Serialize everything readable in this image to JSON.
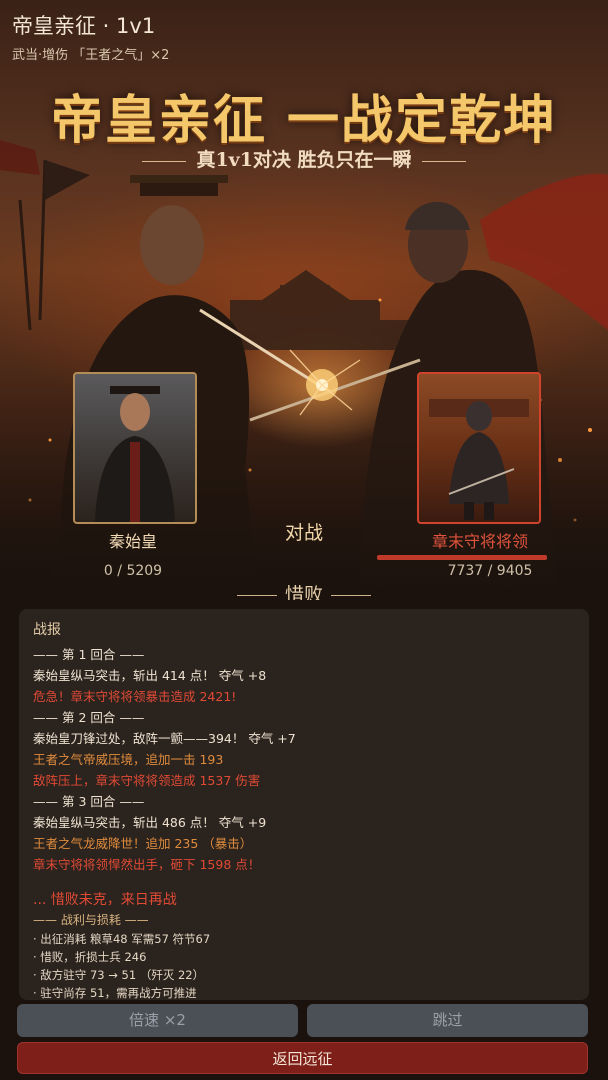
{
  "header": {
    "title": "帝皇亲征 · 1v1",
    "subtitle": "武当·增伤 「王者之气」×2"
  },
  "banner": {
    "title": "帝皇亲征 一战定乾坤",
    "tagline": "真1v1对决 胜负只在一瞬"
  },
  "battle": {
    "left": {
      "name": "秦始皇",
      "hp": "0 / 5209"
    },
    "vs": "对战",
    "right": {
      "name": "章末守将将领",
      "hp": "7737 / 9405"
    },
    "result": "惜败"
  },
  "log": {
    "heading": "战报",
    "lines": [
      "—— 第 1 回合 ——",
      "秦始皇纵马突击，斩出 414 点！ 夺气 +8",
      "危急！章末守将将领暴击造成 2421!",
      "—— 第 2 回合 ——",
      "秦始皇刀锋过处，敌阵一颤——394！ 夺气 +7",
      "王者之气帝威压境，追加一击 193",
      "敌阵压上，章末守将将领造成 1537 伤害",
      "—— 第 3 回合 ——",
      "秦始皇纵马突击，斩出 486 点！ 夺气 +9",
      "王者之气龙威降世！追加 235 （暴击）",
      "章末守将将领悍然出手，砸下 1598 点！",
      "... 惜败未克，来日再战",
      "—— 战利与损耗 ——",
      "· 出征消耗 粮草48 军需57 符节67",
      "· 惜败，折损士兵 246",
      "· 敌方驻守 73 → 51 （歼灭 22）",
      "· 驻守尚存 51，需再战方可推进"
    ]
  },
  "buttons": {
    "speed": "倍速 ×2",
    "skip": "跳过",
    "return": "返回远征"
  }
}
